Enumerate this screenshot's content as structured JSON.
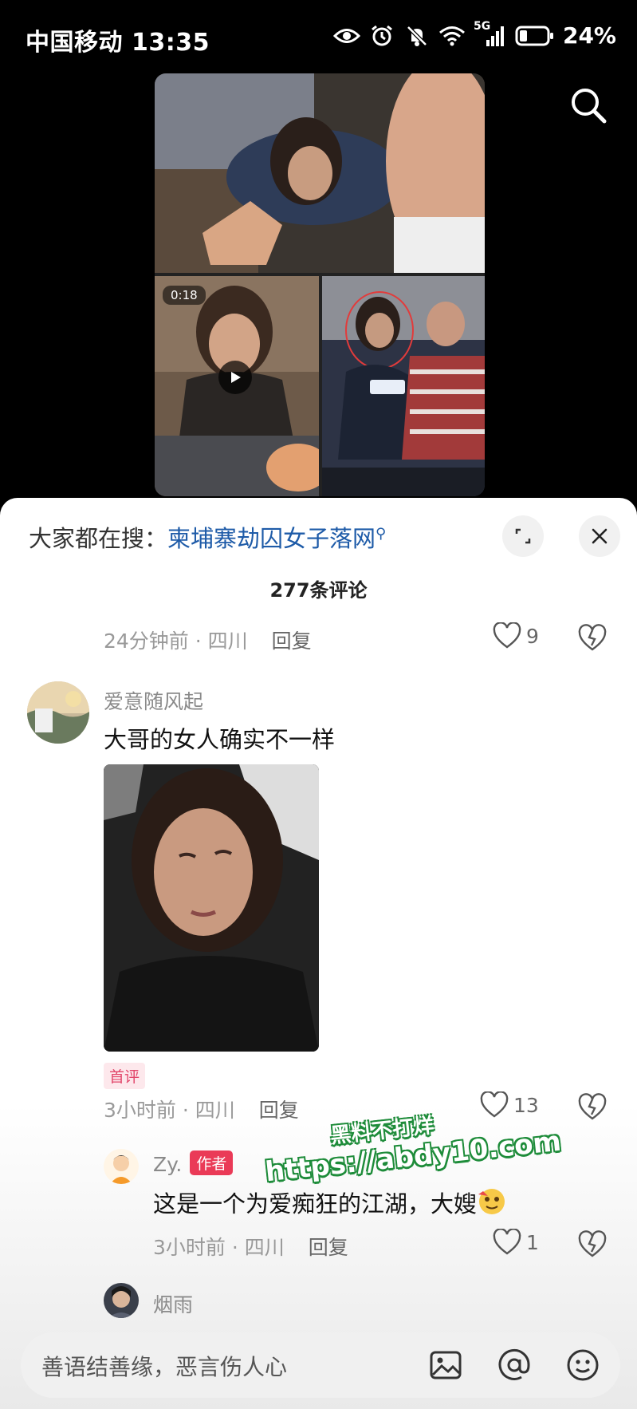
{
  "status_bar": {
    "carrier_time": "中国移动 13:35",
    "network": "5G",
    "battery": "24%"
  },
  "video": {
    "duration": "0:18"
  },
  "sheet": {
    "hot_search_prefix": "大家都在搜：",
    "hot_search_term": "柬埔寨劫囚女子落网",
    "comment_count": "277条评论",
    "first_comment_meta": {
      "time_location": "24分钟前 · 四川",
      "reply": "回复",
      "likes": "9"
    },
    "comment": {
      "user": "爱意随风起",
      "text": "大哥的女人确实不一样",
      "badge": "首评",
      "time_location": "3小时前 · 四川",
      "reply": "回复",
      "likes": "13"
    },
    "reply_comment": {
      "user": "Zy.",
      "badge": "作者",
      "text": "这是一个为爱痴狂的江湖，大嫂",
      "time_location": "3小时前 · 四川",
      "reply": "回复",
      "likes": "1"
    },
    "next_comment": {
      "user": "烟雨"
    },
    "watermark": {
      "line1": "黑料不打烊",
      "line2": "https://abdy10.com"
    },
    "input": {
      "placeholder": "善语结善缘，恶言伤人心"
    }
  }
}
